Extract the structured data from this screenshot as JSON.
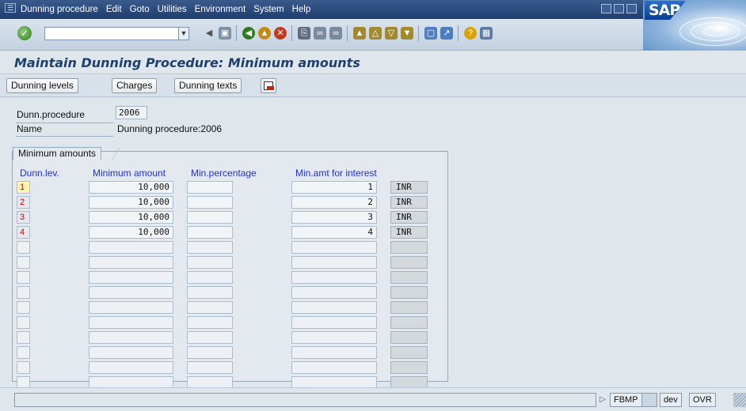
{
  "menu": {
    "items": [
      "Dunning procedure",
      "Edit",
      "Goto",
      "Utilities",
      "Environment",
      "System",
      "Help"
    ]
  },
  "logo": {
    "text": "SAP"
  },
  "toolbar": {
    "command_field": "",
    "icons": [
      "enter-icon",
      "back-icon",
      "exit-icon",
      "cancel-icon",
      "print-icon",
      "find-icon",
      "find-next-icon",
      "first-page-icon",
      "previous-page-icon",
      "next-page-icon",
      "last-page-icon",
      "create-session-icon",
      "shortcut-icon",
      "help-icon",
      "layout-menu-icon"
    ]
  },
  "title": "Maintain Dunning Procedure: Minimum amounts",
  "app_toolbar": {
    "dunning_levels": "Dunning levels",
    "charges": "Charges",
    "dunning_texts": "Dunning texts"
  },
  "fields": {
    "dunn_procedure_label": "Dunn.procedure",
    "dunn_procedure_value": "2006",
    "name_label": "Name",
    "name_value": "Dunning procedure:2006"
  },
  "group": {
    "title": "Minimum amounts",
    "columns": [
      "Dunn.lev.",
      "Minimum amount",
      "Min.percentage",
      "Min.amt for interest"
    ],
    "rows": [
      {
        "level": "1",
        "min_amount": "10,000",
        "min_pct": "",
        "min_interest": "1",
        "currency": "INR"
      },
      {
        "level": "2",
        "min_amount": "10,000",
        "min_pct": "",
        "min_interest": "2",
        "currency": "INR"
      },
      {
        "level": "3",
        "min_amount": "10,000",
        "min_pct": "",
        "min_interest": "3",
        "currency": "INR"
      },
      {
        "level": "4",
        "min_amount": "10,000",
        "min_pct": "",
        "min_interest": "4",
        "currency": "INR"
      }
    ],
    "empty_rows": 10
  },
  "status": {
    "message": "",
    "system": "FBMP",
    "client": "dev",
    "mode": "OVR"
  },
  "colors": {
    "menubar": "#1f3d70",
    "title_text": "#1f3f6e",
    "column_header": "#1f2fd6",
    "level_text": "#d40000"
  }
}
